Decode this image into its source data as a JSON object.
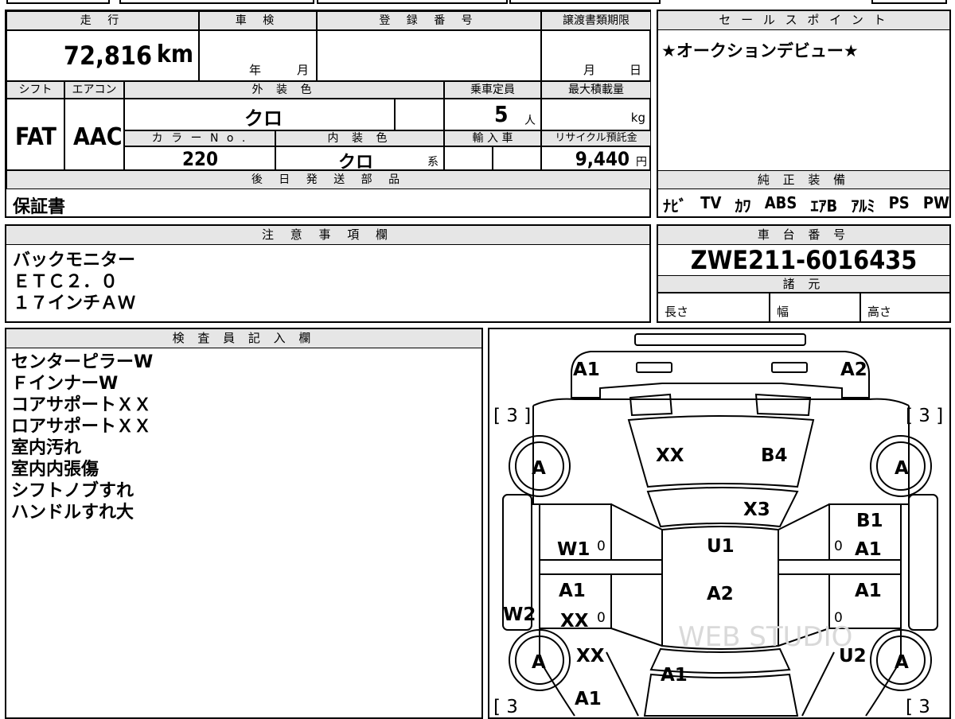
{
  "top_strip": [
    "",
    "",
    "",
    "",
    ""
  ],
  "labels": {
    "mileage": "走 行",
    "inspection": "車 検",
    "registration": "登 録 番 号",
    "transfer_deadline": "譲渡書類期限",
    "sales_point": "セ ー ル ス ポ イ ン ト",
    "shift": "シフト",
    "aircon": "エアコン",
    "exterior_color": "外 装 色",
    "capacity": "乗車定員",
    "max_load": "最大積載量",
    "color_no": "カ ラ ー N o .",
    "interior_color": "内 装 色",
    "import": "輸 入 車",
    "recycle": "リサイクル預託金",
    "later_parts": "後 日 発 送 部 品",
    "equipment": "純 正 装 備",
    "notes": "注 意 事 項 欄",
    "chassis": "車 台 番 号",
    "specs": "諸 元",
    "length": "長さ",
    "width": "幅",
    "height": "高さ",
    "inspector": "検 査 員 記 入 欄"
  },
  "values": {
    "mileage": "72,816",
    "mileage_unit": "km",
    "inspection_year": "年",
    "inspection_month": "月",
    "deadline_month": "月",
    "deadline_day": "日",
    "sales_point_text": "★オークションデビュー★",
    "shift": "FAT",
    "aircon": "AAC",
    "exterior_color": "クロ",
    "capacity": "5",
    "capacity_unit": "人",
    "max_load_unit": "kg",
    "color_no": "220",
    "interior_color": "クロ",
    "interior_suffix": "系",
    "recycle": "9,440",
    "recycle_unit": "円",
    "later_parts": "保証書",
    "equipment": [
      "ﾅﾋﾞ",
      "TV",
      "ｶﾜ",
      "ABS",
      "ｴｱB",
      "ｱﾙﾐ",
      "PS",
      "PW"
    ],
    "notes": [
      "バックモニター",
      "ＥＴＣ２．０",
      "１７インチＡＷ"
    ],
    "chassis": "ZWE211-6016435",
    "inspector": [
      "センターピラーW",
      "ＦインナーW",
      "コアサポートＸＸ",
      "ロアサポートＸＸ",
      "室内汚れ",
      "室内内張傷",
      "シフトノブすれ",
      "ハンドルすれ大"
    ]
  },
  "diagram": {
    "marks": [
      "A1",
      "A2",
      "[ 3 ]",
      "[ 3 ]",
      "XX",
      "B4",
      "A",
      "A",
      "X3",
      "B1",
      "W1",
      "U1",
      "A1",
      "A1",
      "A2",
      "A1",
      "A1",
      "W2",
      "XX",
      "A",
      "A",
      "XX",
      "U2",
      "A1",
      "A1",
      "[ 3",
      "[ 3",
      "0",
      "0",
      "0",
      "0"
    ],
    "watermark": "WEB STUDIO"
  }
}
